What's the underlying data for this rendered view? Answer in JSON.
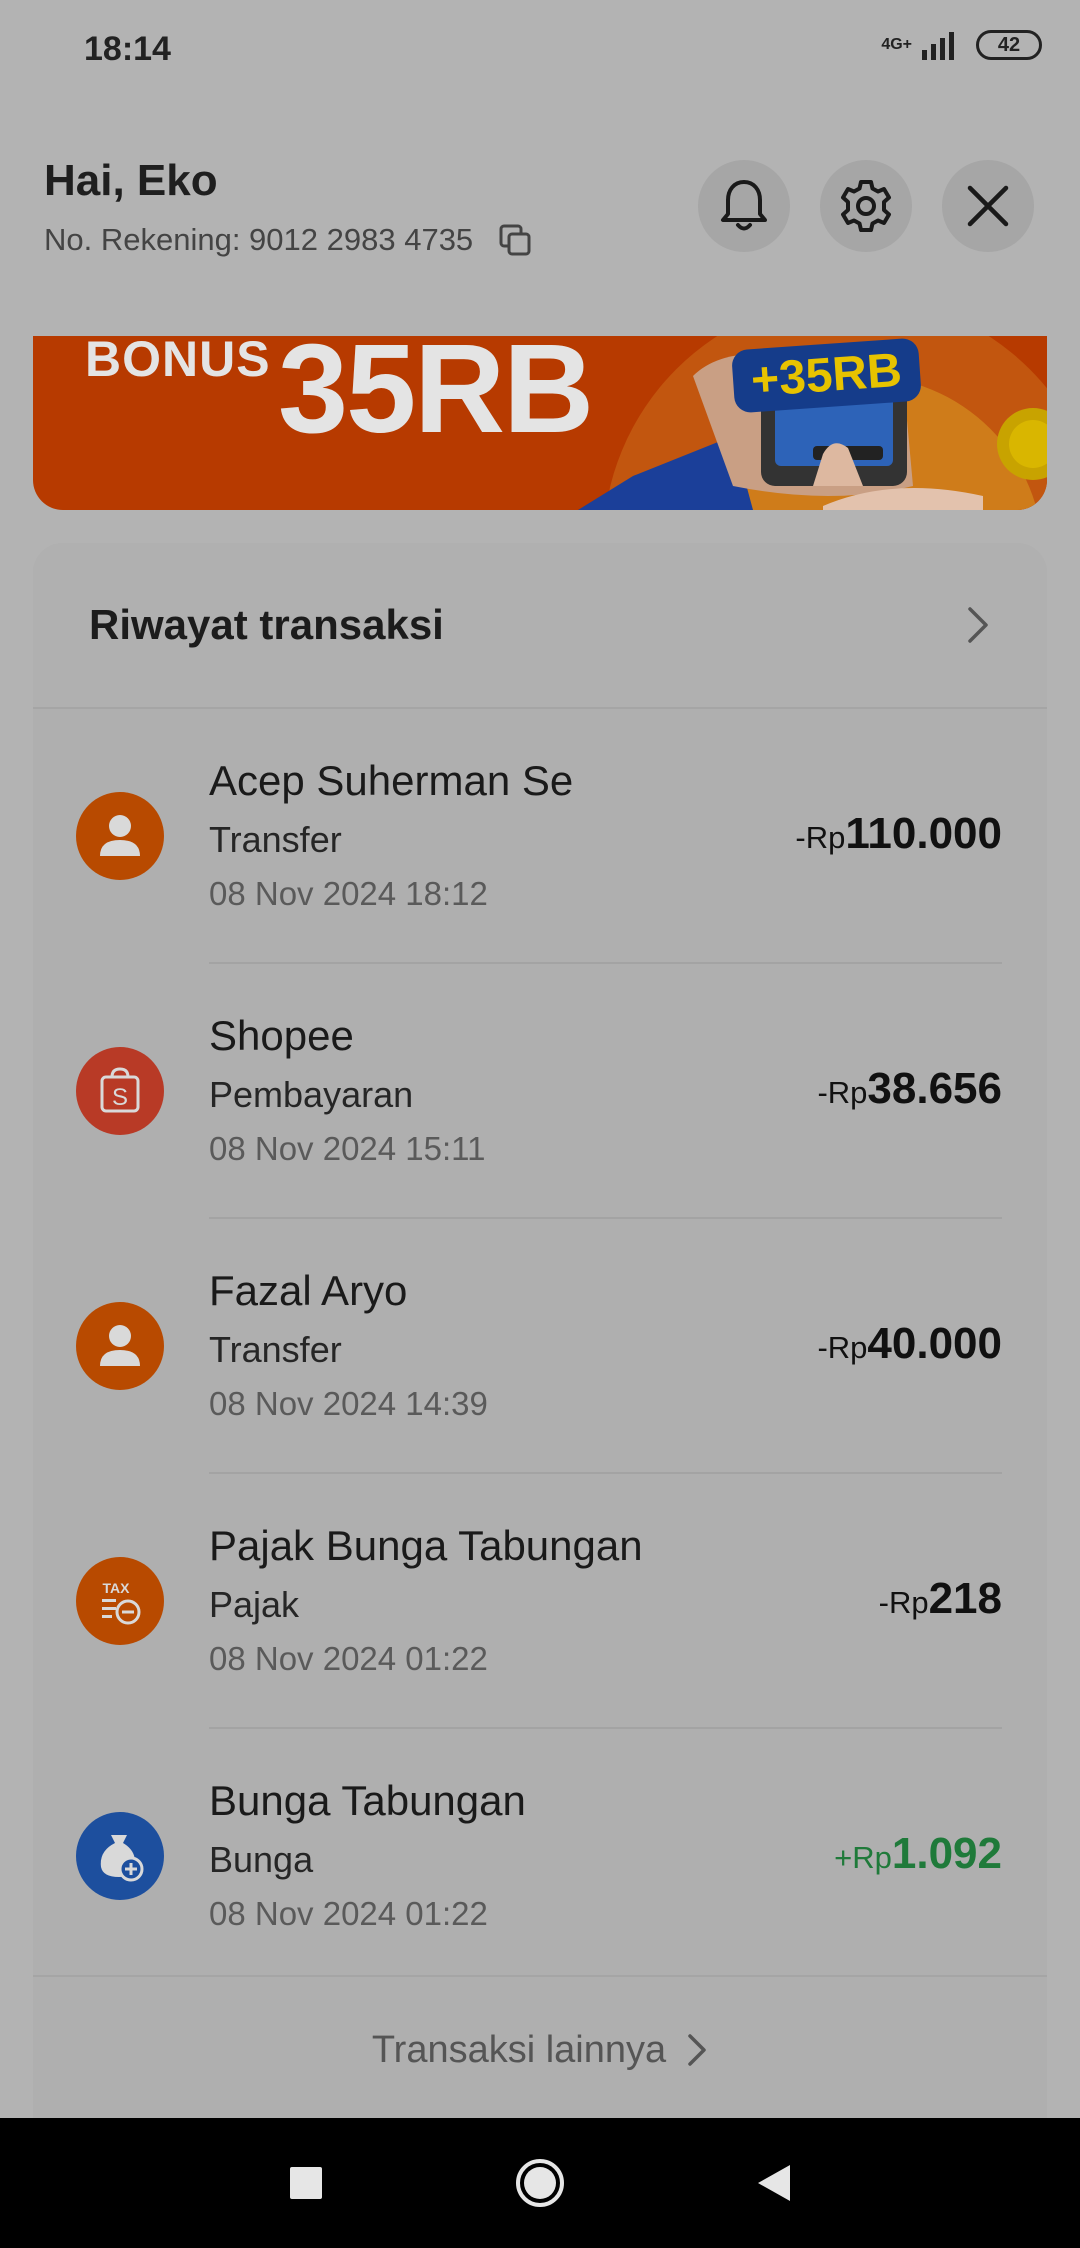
{
  "status_bar": {
    "time": "18:14",
    "network": "4G+",
    "battery": "42"
  },
  "header": {
    "greeting": "Hai, Eko",
    "account_label": "No. Rekening: 9012 2983 4735",
    "icons": [
      "bell-icon",
      "gear-icon",
      "close-icon"
    ]
  },
  "banner": {
    "bonus_label": "BONUS",
    "amount": "35RB",
    "sticker": "+35RB"
  },
  "transactions": {
    "title": "Riwayat transaksi",
    "items": [
      {
        "name": "Acep Suherman Se",
        "type": "Transfer",
        "date": "08 Nov 2024 18:12",
        "prefix": "-Rp",
        "value": "110.000",
        "icon": "person-icon",
        "icon_color": "#b84a00"
      },
      {
        "name": "Shopee",
        "type": "Pembayaran",
        "date": "08 Nov 2024 15:11",
        "prefix": "-Rp",
        "value": "38.656",
        "icon": "shopee-bag-icon",
        "icon_color": "#b83a26"
      },
      {
        "name": "Fazal Aryo",
        "type": "Transfer",
        "date": "08 Nov 2024 14:39",
        "prefix": "-Rp",
        "value": "40.000",
        "icon": "person-icon",
        "icon_color": "#b84a00"
      },
      {
        "name": "Pajak Bunga Tabungan",
        "type": "Pajak",
        "date": "08 Nov 2024 01:22",
        "prefix": "-Rp",
        "value": "218",
        "icon": "tax-icon",
        "icon_color": "#b84a00"
      },
      {
        "name": "Bunga Tabungan",
        "type": "Bunga",
        "date": "08 Nov 2024 01:22",
        "prefix": "+Rp",
        "value": "1.092",
        "icon": "money-bag-icon",
        "icon_color": "#1d4f9e",
        "positive": true
      }
    ],
    "more_label": "Transaksi lainnya"
  },
  "nav_bar": {
    "icons": [
      "recent-apps-icon",
      "home-icon",
      "back-icon"
    ]
  }
}
